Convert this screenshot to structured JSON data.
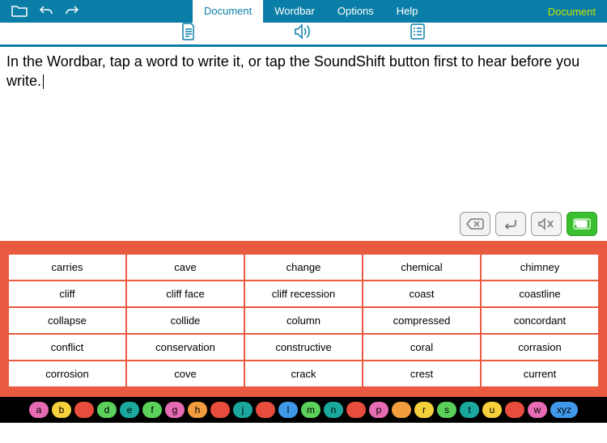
{
  "topbar": {
    "tabs": [
      "Document",
      "Wordbar",
      "Options",
      "Help"
    ],
    "active_tab": "Document",
    "right_label": "Document"
  },
  "editor": {
    "text": "In the Wordbar, tap a word to write it, or tap the SoundShift button first to hear before you write."
  },
  "wordbar": {
    "words": [
      "carries",
      "cave",
      "change",
      "chemical",
      "chimney",
      "cliff",
      "cliff face",
      "cliff recession",
      "coast",
      "coastline",
      "collapse",
      "collide",
      "column",
      "compressed",
      "concordant",
      "conflict",
      "conservation",
      "constructive",
      "coral",
      "corrasion",
      "corrosion",
      "cove",
      "crack",
      "crest",
      "current"
    ]
  },
  "letterbar": {
    "items": [
      {
        "label": "a",
        "cls": "c-pink"
      },
      {
        "label": "b",
        "cls": "c-yellow"
      },
      {
        "label": "",
        "cls": "c-red"
      },
      {
        "label": "d",
        "cls": "c-green"
      },
      {
        "label": "e",
        "cls": "c-teal"
      },
      {
        "label": "f",
        "cls": "c-green"
      },
      {
        "label": "g",
        "cls": "c-pink"
      },
      {
        "label": "h",
        "cls": "c-orange"
      },
      {
        "label": "",
        "cls": "c-red"
      },
      {
        "label": "j",
        "cls": "c-teal"
      },
      {
        "label": "",
        "cls": "c-red"
      },
      {
        "label": "l",
        "cls": "c-blue"
      },
      {
        "label": "m",
        "cls": "c-green"
      },
      {
        "label": "n",
        "cls": "c-teal"
      },
      {
        "label": "",
        "cls": "c-red"
      },
      {
        "label": "p",
        "cls": "c-pink"
      },
      {
        "label": "",
        "cls": "c-orange"
      },
      {
        "label": "r",
        "cls": "c-yellow"
      },
      {
        "label": "s",
        "cls": "c-green"
      },
      {
        "label": "t",
        "cls": "c-teal"
      },
      {
        "label": "u",
        "cls": "c-yellow"
      },
      {
        "label": "",
        "cls": "c-red"
      },
      {
        "label": "w",
        "cls": "c-pink"
      },
      {
        "label": "xyz",
        "cls": "c-blue",
        "wide": true
      }
    ]
  }
}
